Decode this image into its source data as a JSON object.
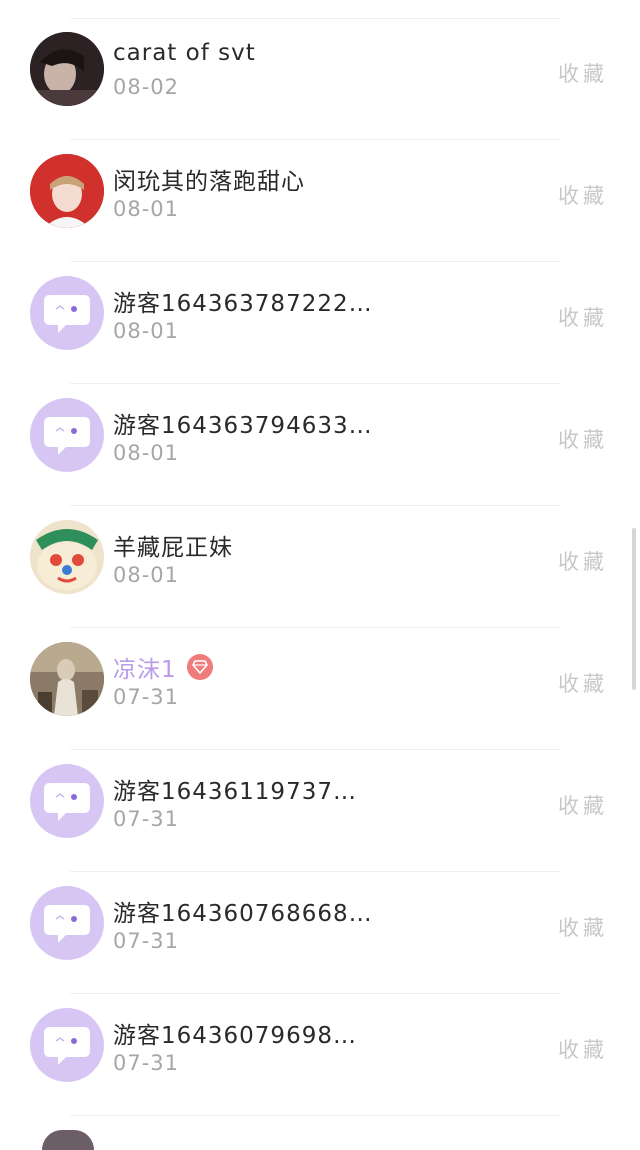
{
  "list": {
    "items": [
      {
        "name": "carat of svt",
        "date": "08-02",
        "action": "收藏",
        "avatar": "photo",
        "avatar_colors": [
          "#3a2a2c",
          "#c9b2a8"
        ],
        "vip": false
      },
      {
        "name": "闵玧其的落跑甜心",
        "date": "08-01",
        "action": "收藏",
        "avatar": "photo",
        "avatar_colors": [
          "#d0312d",
          "#f3dccf"
        ],
        "vip": false
      },
      {
        "name": "游客164363787222…",
        "date": "08-01",
        "action": "收藏",
        "avatar": "default",
        "vip": false
      },
      {
        "name": "游客164363794633…",
        "date": "08-01",
        "action": "收藏",
        "avatar": "default",
        "vip": false
      },
      {
        "name": "羊藏屁正妹",
        "date": "08-01",
        "action": "收藏",
        "avatar": "photo",
        "avatar_colors": [
          "#f4e6c8",
          "#e24b3a"
        ],
        "vip": false
      },
      {
        "name": "凉沫1",
        "date": "07-31",
        "action": "收藏",
        "avatar": "photo",
        "avatar_colors": [
          "#7a6a58",
          "#d8cbb8"
        ],
        "vip": true
      },
      {
        "name": "游客16436119737…",
        "date": "07-31",
        "action": "收藏",
        "avatar": "default",
        "vip": false
      },
      {
        "name": "游客164360768668…",
        "date": "07-31",
        "action": "收藏",
        "avatar": "default",
        "vip": false
      },
      {
        "name": "游客16436079698…",
        "date": "07-31",
        "action": "收藏",
        "avatar": "default",
        "vip": false
      }
    ]
  },
  "colors": {
    "default_avatar_bg": "#d7c6f4",
    "vip_name": "#b89bea",
    "vip_badge": "#f07b7b",
    "action_text": "#c8c8c8",
    "date_text": "#a6a6a6"
  }
}
